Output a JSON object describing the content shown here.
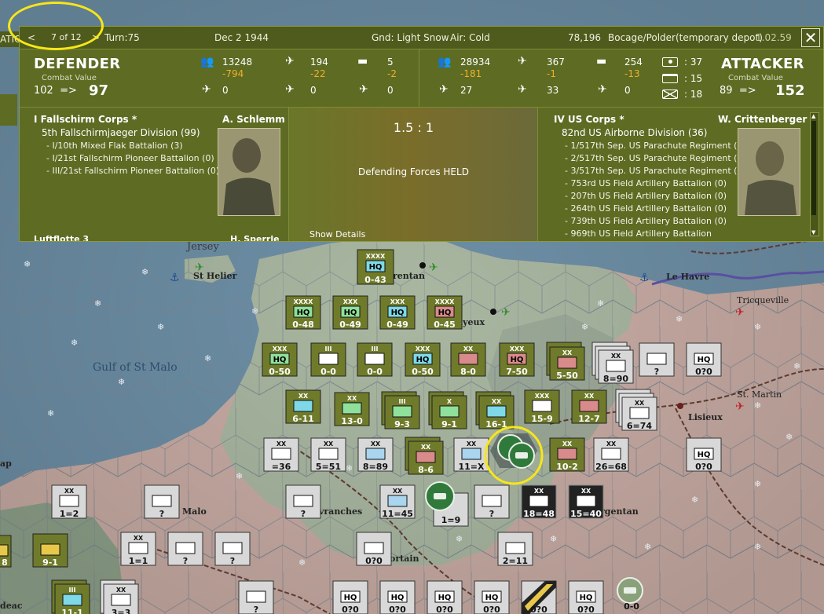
{
  "nav": {
    "prev": "<",
    "page": "7 of 12",
    "next": ">",
    "left_edge": "ATIO"
  },
  "header": {
    "turn": "Turn:75",
    "date": "Dec 2 1944",
    "ground": "Gnd: Light Snow",
    "air": "Air: Cold",
    "hex_id": "78,196",
    "terrain": "Bocage/Polder(temporary depot)",
    "version": "1.02.59",
    "close": "✕"
  },
  "defender": {
    "title": "DEFENDER",
    "cv_label": "Combat Value",
    "cv_from": "102",
    "arrow": "=>",
    "cv_to": "97",
    "men": "13248",
    "men_loss": "-794",
    "aircraft": "194",
    "aircraft_loss": "-22",
    "tanks": "5",
    "tanks_loss": "-2",
    "row2_a": "0",
    "row2_b": "0",
    "row2_c": "0",
    "corps": "I Fallschirm Corps *",
    "commander": "A. Schlemm",
    "division": "5th Fallschirmjaeger Division (99)",
    "units": [
      "- I/10th Mixed Flak Battalion (3)",
      "- I/21st Fallschirm Pioneer Battalion (0)",
      "- III/21st Fallschirm Pioneer Battalion (0)"
    ],
    "cut_left": "Luftflotte 3",
    "cut_right": "H. Sperrle"
  },
  "attacker": {
    "title": "ATTACKER",
    "cv_label": "Combat Value",
    "cv_from": "89",
    "arrow": "=>",
    "cv_to": "152",
    "men": "28934",
    "men_loss": "-181",
    "aircraft": "367",
    "aircraft_loss": "-1",
    "tanks": "254",
    "tanks_loss": "-13",
    "row2_a": "27",
    "row2_b": "33",
    "row2_c": "0",
    "count_a": ": 37",
    "count_b": ": 15",
    "count_c": ": 18",
    "corps": "IV US Corps *",
    "commander": "W. Crittenberger",
    "division": "82nd US Airborne Division (36)",
    "units": [
      "- 1/517th Sep. US Parachute Regiment (+) (4)",
      "- 2/517th Sep. US Parachute Regiment (+) (7)",
      "- 3/517th Sep. US Parachute Regiment (+) (6)",
      "- 753rd US Field Artillery Battalion (0)",
      "- 207th US Field Artillery Battalion (0)",
      "- 264th US Field Artillery Battalion (0)",
      "- 739th US Field Artillery Battalion (0)"
    ],
    "cut": "- 969th US Field Artillery Battalion"
  },
  "result": {
    "odds": "1.5 : 1",
    "outcome": "Defending Forces HELD",
    "details": "Show Details"
  },
  "map_labels": {
    "jersey": "Jersey",
    "st_helier": "St Helier",
    "gulf": "Gulf of St Malo",
    "le_havre": "Le Havre",
    "tricqueville": "Tricqueville",
    "st_martin": "St. Martin",
    "lisieux": "Lisieux",
    "carentan": "rentan",
    "bayeux": "ayeux",
    "malo": "Malo",
    "avranches": "vranches",
    "argentan": "rgentan",
    "mortain": "ortain",
    "edge_ap": "ap",
    "edge_deac": "deac"
  },
  "counters": {
    "c1": {
      "top": "XXXX",
      "mid": "HQ",
      "val": "0-43"
    },
    "c2": {
      "top": "XXXX",
      "mid": "HQ",
      "val": "0-48"
    },
    "c3": {
      "top": "XXX",
      "mid": "HQ",
      "val": "0-49"
    },
    "c4": {
      "top": "XXX",
      "mid": "HQ",
      "val": "0-49"
    },
    "c5": {
      "top": "XXXX",
      "mid": "HQ",
      "val": "0-45"
    },
    "c6": {
      "top": "XXX",
      "mid": "HQ",
      "val": "0-50"
    },
    "c7": {
      "top": "III",
      "val": "0-0"
    },
    "c8": {
      "top": "III",
      "val": "0-0"
    },
    "c9": {
      "top": "XXX",
      "mid": "HQ",
      "val": "0-50"
    },
    "c10": {
      "top": "XX",
      "val": "8-0"
    },
    "c11": {
      "top": "XXX",
      "mid": "HQ",
      "val": "7-50"
    },
    "c12": {
      "top": "XX",
      "val": "5-50"
    },
    "c13": {
      "top": "XX",
      "val": "8=90"
    },
    "c14": {
      "val": "?"
    },
    "c15": {
      "mid": "HQ",
      "val": "0?0"
    },
    "c16": {
      "top": "XX",
      "val": "6-11"
    },
    "c17": {
      "top": "XX",
      "val": "13-0"
    },
    "c18": {
      "top": "III",
      "val": "9-3"
    },
    "c19": {
      "top": "X",
      "val": "9-1"
    },
    "c20": {
      "top": "XX",
      "val": "16-1"
    },
    "c21": {
      "top": "XXX",
      "val": "15-9"
    },
    "c22": {
      "top": "XX",
      "val": "12-7"
    },
    "c23": {
      "top": "XX",
      "val": "6=74"
    },
    "c24": {
      "top": "XX",
      "val": "=36"
    },
    "c25": {
      "top": "XX",
      "val": "5=51"
    },
    "c26": {
      "top": "XX",
      "val": "8=89"
    },
    "c27": {
      "top": "XX",
      "val": "8-6"
    },
    "c28": {
      "top": "XX",
      "val": "11=X"
    },
    "c29": {
      "top": "XX",
      "val": "10-2"
    },
    "c30": {
      "top": "XX",
      "val": "26=68"
    },
    "c31": {
      "mid": "HQ",
      "val": "0?0"
    },
    "c32": {
      "top": "XX",
      "val": "1=2"
    },
    "c33": {
      "val": "?"
    },
    "c34": {
      "val": "?"
    },
    "c35": {
      "top": "XX",
      "val": "11=45"
    },
    "c36": {
      "val": "1=9"
    },
    "c37": {
      "val": "?"
    },
    "c38": {
      "top": "XX",
      "val": "18=48"
    },
    "c39": {
      "top": "XX",
      "val": "15=40"
    },
    "c40": {
      "val": "9-1"
    },
    "c41": {
      "top": "XX",
      "val": "1=1"
    },
    "c42": {
      "val": "?"
    },
    "c43": {
      "val": "?"
    },
    "c44": {
      "val": "0?0"
    },
    "c45": {
      "val": "2=11"
    },
    "c46": {
      "top": "III",
      "val": "11-1"
    },
    "c47": {
      "top": "XX",
      "val": "3=3"
    },
    "c48": {
      "val": "?"
    },
    "c49": {
      "mid": "HQ",
      "val": "0?0"
    },
    "c50": {
      "mid": "HQ",
      "val": "0?0"
    },
    "c51": {
      "mid": "HQ",
      "val": "0?0"
    },
    "c52": {
      "mid": "HQ",
      "val": "0?0"
    },
    "c53": {
      "val": "0?0"
    },
    "c54": {
      "mid": "HQ",
      "val": "0?0"
    },
    "c55": {
      "val": "0-0"
    },
    "c56": {
      "val": "8"
    }
  },
  "colors": {
    "panel": "#5d6b23",
    "loss": "#f0b12a",
    "highlight": "#f7e618",
    "ocean": "#6d8fa6",
    "land_green": "#a9b7a1",
    "land_pink": "#c8aca4"
  }
}
